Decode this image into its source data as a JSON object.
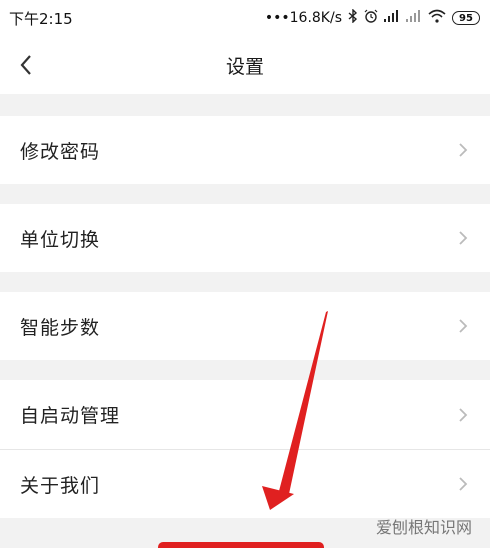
{
  "status_bar": {
    "time": "下午2:15",
    "network_speed": "•••16.8K/s",
    "battery": "95"
  },
  "nav": {
    "title": "设置"
  },
  "settings": {
    "items": [
      {
        "label": "修改密码"
      },
      {
        "label": "单位切换"
      },
      {
        "label": "智能步数"
      },
      {
        "label": "自启动管理"
      },
      {
        "label": "关于我们"
      }
    ]
  },
  "watermark": "爱刨根知识网",
  "colors": {
    "accent_red": "#e02020",
    "row_bg": "#ffffff",
    "page_bg": "#f2f2f2"
  }
}
